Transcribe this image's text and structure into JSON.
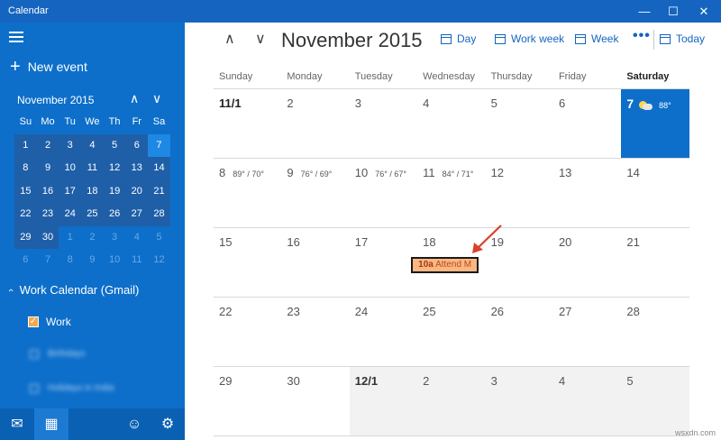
{
  "app": {
    "title": "Calendar"
  },
  "window_controls": {
    "minimize": "—",
    "maximize": "☐",
    "close": "✕"
  },
  "sidebar": {
    "new_event_label": "New event",
    "mini_calendar": {
      "title": "November 2015",
      "day_headers": [
        "Su",
        "Mo",
        "Tu",
        "We",
        "Th",
        "Fr",
        "Sa"
      ],
      "weeks": [
        [
          "1",
          "2",
          "3",
          "4",
          "5",
          "6",
          "7"
        ],
        [
          "8",
          "9",
          "10",
          "11",
          "12",
          "13",
          "14"
        ],
        [
          "15",
          "16",
          "17",
          "18",
          "19",
          "20",
          "21"
        ],
        [
          "22",
          "23",
          "24",
          "25",
          "26",
          "27",
          "28"
        ],
        [
          "29",
          "30",
          "1",
          "2",
          "3",
          "4",
          "5"
        ],
        [
          "6",
          "7",
          "8",
          "9",
          "10",
          "11",
          "12"
        ]
      ],
      "selected_day": "7"
    },
    "calendar_group": "Work Calendar (Gmail)",
    "calendars": [
      {
        "name": "Work",
        "checked": true
      },
      {
        "name": "Birthdays",
        "checked": false
      },
      {
        "name": "Holidays in India",
        "checked": false
      }
    ]
  },
  "toolbar": {
    "month_title": "November 2015",
    "day_label": "Day",
    "work_week_label": "Work week",
    "week_label": "Week",
    "today_label": "Today",
    "more": "•••"
  },
  "month": {
    "day_names": [
      "Sunday",
      "Monday",
      "Tuesday",
      "Wednesday",
      "Thursday",
      "Friday",
      "Saturday"
    ],
    "weeks": [
      [
        {
          "n": "11/1"
        },
        {
          "n": "2"
        },
        {
          "n": "3"
        },
        {
          "n": "4"
        },
        {
          "n": "5"
        },
        {
          "n": "6"
        },
        {
          "n": "7",
          "wx": "88°"
        }
      ],
      [
        {
          "n": "8",
          "wx": "89° / 70°"
        },
        {
          "n": "9",
          "wx": "76° / 69°"
        },
        {
          "n": "10",
          "wx": "76° / 67°"
        },
        {
          "n": "11",
          "wx": "84° / 71°"
        },
        {
          "n": "12"
        },
        {
          "n": "13"
        },
        {
          "n": "14"
        }
      ],
      [
        {
          "n": "15"
        },
        {
          "n": "16"
        },
        {
          "n": "17"
        },
        {
          "n": "18"
        },
        {
          "n": "19"
        },
        {
          "n": "20"
        },
        {
          "n": "21"
        }
      ],
      [
        {
          "n": "22"
        },
        {
          "n": "23"
        },
        {
          "n": "24"
        },
        {
          "n": "25"
        },
        {
          "n": "26"
        },
        {
          "n": "27"
        },
        {
          "n": "28"
        }
      ],
      [
        {
          "n": "29"
        },
        {
          "n": "30"
        },
        {
          "n": "12/1"
        },
        {
          "n": "2"
        },
        {
          "n": "3"
        },
        {
          "n": "4"
        },
        {
          "n": "5"
        }
      ]
    ],
    "event": {
      "time": "10a",
      "title": "Attend M"
    }
  },
  "watermark": "wsxdn.com",
  "colors": {
    "accent": "#0d6fca",
    "event_bg": "#fbb783",
    "annotation_arrow": "#d9412b"
  }
}
